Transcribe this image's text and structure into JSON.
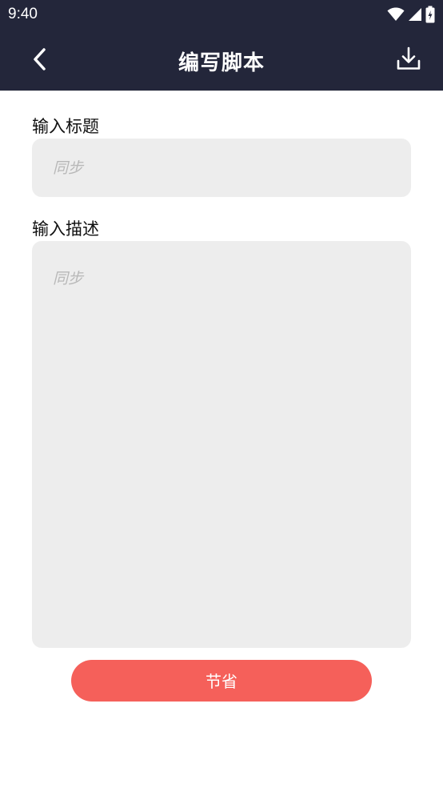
{
  "status_bar": {
    "time": "9:40",
    "icons": [
      "wifi-icon",
      "signal-icon",
      "battery-icon"
    ]
  },
  "app_bar": {
    "title": "编写脚本",
    "back_icon": "chevron-left-icon",
    "download_icon": "download-icon",
    "background_color": "#23263a"
  },
  "form": {
    "title_label": "输入标题",
    "title_placeholder": "同步",
    "title_value": "",
    "description_label": "输入描述",
    "description_placeholder": "同步",
    "description_value": ""
  },
  "actions": {
    "save_label": "节省",
    "save_color": "#f5605a"
  }
}
